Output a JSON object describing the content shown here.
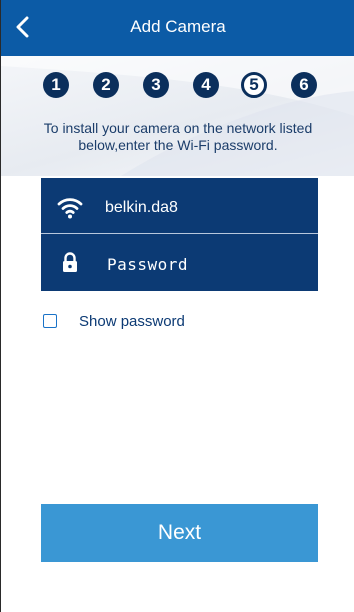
{
  "header": {
    "title": "Add Camera"
  },
  "steps": [
    "1",
    "2",
    "3",
    "4",
    "5",
    "6"
  ],
  "current_step": "5",
  "instructions": "To install your camera on the network listed below,enter the Wi-Fi password.",
  "network": {
    "icon": "wifi-icon",
    "name": "belkin.da8"
  },
  "password_field": {
    "icon": "lock-icon",
    "placeholder": "Password",
    "value": ""
  },
  "show_password": {
    "label": "Show password",
    "checked": false
  },
  "next_button": {
    "label": "Next"
  },
  "colors": {
    "appbar": "#0c5ba6",
    "field_box": "#0c3a74",
    "step_circle": "#0b2f5c",
    "next_button": "#3a97d4"
  }
}
